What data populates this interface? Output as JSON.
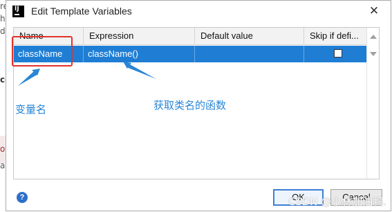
{
  "background": {
    "left_text": [
      "re",
      "h",
      "du",
      "ce",
      "ol",
      "a"
    ]
  },
  "dialog": {
    "title": "Edit Template Variables",
    "close_glyph": "✕",
    "icon_text": "IJ"
  },
  "table": {
    "headers": [
      "Name",
      "Expression",
      "Default value",
      "Skip if defi..."
    ],
    "rows": [
      {
        "name": "className",
        "expression": "className()",
        "default_value": "",
        "skip_if_defined": false
      }
    ]
  },
  "footer": {
    "help_glyph": "?",
    "ok_label": "OK",
    "cancel_label": "Cancel"
  },
  "annotations": {
    "left_label": "变量名",
    "right_label": "获取类名的函数",
    "colors": {
      "box": "#e2332a",
      "text": "#2a86d6"
    }
  },
  "watermark": "CSDN @小林加油鸭."
}
